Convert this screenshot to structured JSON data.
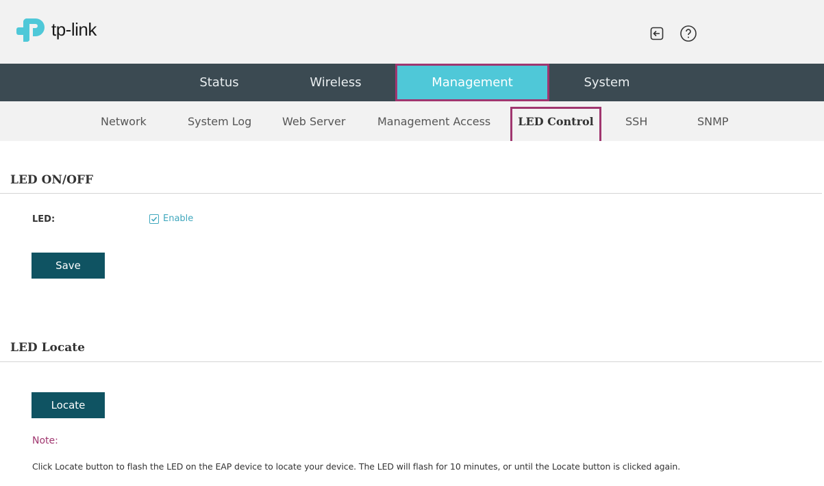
{
  "header": {
    "brand": "tp-link",
    "brand_color": "#4fc8d8",
    "icons": [
      "logout-icon",
      "help-icon"
    ]
  },
  "main_nav": {
    "tabs": [
      {
        "label": "Status"
      },
      {
        "label": "Wireless"
      },
      {
        "label": "Management",
        "active": true
      },
      {
        "label": "System"
      }
    ],
    "active_color": "#4fc8d8",
    "highlight_color": "#a0366f"
  },
  "sub_nav": {
    "items": [
      {
        "label": "Network"
      },
      {
        "label": "System Log"
      },
      {
        "label": "Web Server"
      },
      {
        "label": "Management Access"
      },
      {
        "label": "LED Control",
        "active": true
      },
      {
        "label": "SSH"
      },
      {
        "label": "SNMP"
      }
    ]
  },
  "led_onoff": {
    "title": "LED ON/OFF",
    "led_label": "LED:",
    "enable_label": "Enable",
    "enable_checked": true,
    "save_label": "Save"
  },
  "led_locate": {
    "title": "LED Locate",
    "locate_label": "Locate",
    "note_title": "Note:",
    "note_text": "Click Locate button to flash the LED on the EAP device to locate your device. The LED will flash for 10 minutes, or until the Locate button is clicked again."
  }
}
